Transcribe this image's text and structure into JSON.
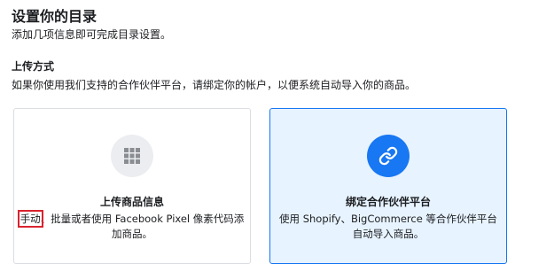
{
  "header": {
    "title": "设置你的目录",
    "subtitle": "添加几项信息即可完成目录设置。"
  },
  "upload_method": {
    "title": "上传方式",
    "description": "如果你使用我们支持的合作伙伴平台，请绑定你的帐户，以便系统自动导入你的商品。"
  },
  "options": [
    {
      "title": "上传商品信息",
      "desc_highlight": "手动",
      "desc_rest": "、批量或者使用 Facebook Pixel 像素代码添加商品。",
      "icon": "grid-icon",
      "selected": false
    },
    {
      "title": "绑定合作伙伴平台",
      "description": "使用 Shopify、BigCommerce 等合作伙伴平台自动导入商品。",
      "icon": "link-icon",
      "selected": true
    }
  ],
  "colors": {
    "accent": "#1877f2",
    "selected_bg": "#e7f3ff",
    "highlight_box": "#d9232e",
    "icon_grey": "#ebedf0",
    "grid_icon": "#8a8d91"
  }
}
